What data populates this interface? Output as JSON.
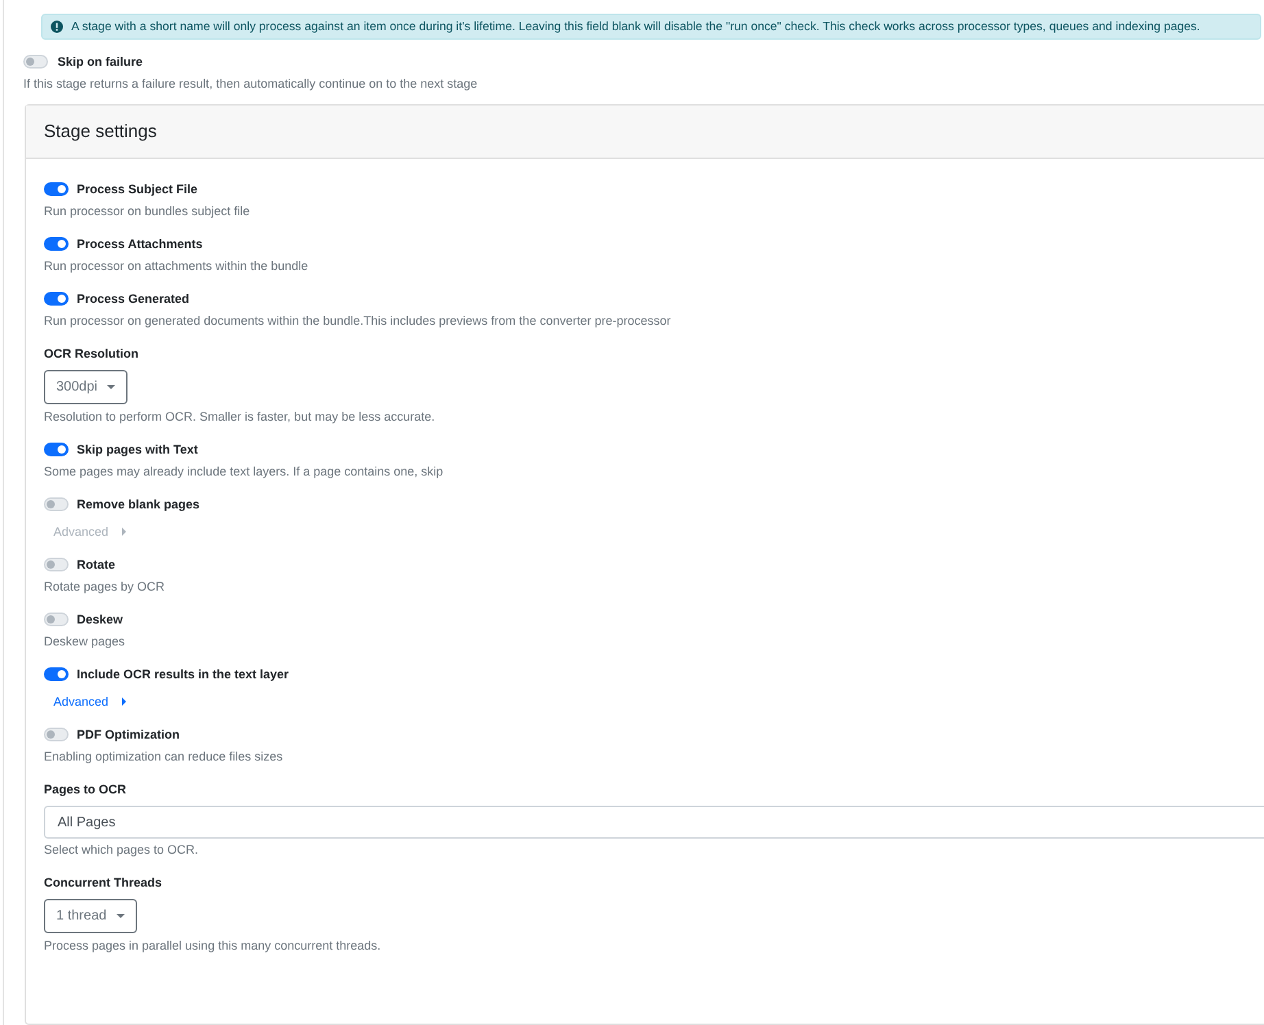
{
  "alert": {
    "text": "A stage with a short name will only process against an item once during it's lifetime. Leaving this field blank will disable the \"run once\" check. This check works across processor types, queues and indexing pages."
  },
  "skip_on_failure": {
    "label": "Skip on failure",
    "on": false,
    "description": "If this stage returns a failure result, then automatically continue on to the next stage"
  },
  "card": {
    "title": "Stage settings",
    "settings": [
      {
        "kind": "toggle",
        "label": "Process Subject File",
        "on": true,
        "description": "Run processor on bundles subject file"
      },
      {
        "kind": "toggle",
        "label": "Process Attachments",
        "on": true,
        "description": "Run processor on attachments within the bundle"
      },
      {
        "kind": "toggle",
        "label": "Process Generated",
        "on": true,
        "description": "Run processor on generated documents within the bundle.This includes previews from the converter pre-processor"
      },
      {
        "kind": "dropdown",
        "label": "OCR Resolution",
        "value": "300dpi",
        "description": "Resolution to perform OCR. Smaller is faster, but may be less accurate."
      },
      {
        "kind": "toggle",
        "label": "Skip pages with Text",
        "on": true,
        "description": "Some pages may already include text layers. If a page contains one, skip"
      },
      {
        "kind": "toggle",
        "label": "Remove blank pages",
        "on": false,
        "advanced": {
          "label": "Advanced",
          "disabled": true
        }
      },
      {
        "kind": "toggle",
        "label": "Rotate",
        "on": false,
        "description": "Rotate pages by OCR"
      },
      {
        "kind": "toggle",
        "label": "Deskew",
        "on": false,
        "description": "Deskew pages"
      },
      {
        "kind": "toggle",
        "label": "Include OCR results in the text layer",
        "on": true,
        "advanced": {
          "label": "Advanced",
          "disabled": false
        }
      },
      {
        "kind": "toggle",
        "label": "PDF Optimization",
        "on": false,
        "description": "Enabling optimization can reduce files sizes"
      },
      {
        "kind": "select",
        "label": "Pages to OCR",
        "value": "All Pages",
        "description": "Select which pages to OCR."
      },
      {
        "kind": "dropdown",
        "label": "Concurrent Threads",
        "value": "1 thread",
        "description": "Process pages in parallel using this many concurrent threads."
      }
    ]
  }
}
